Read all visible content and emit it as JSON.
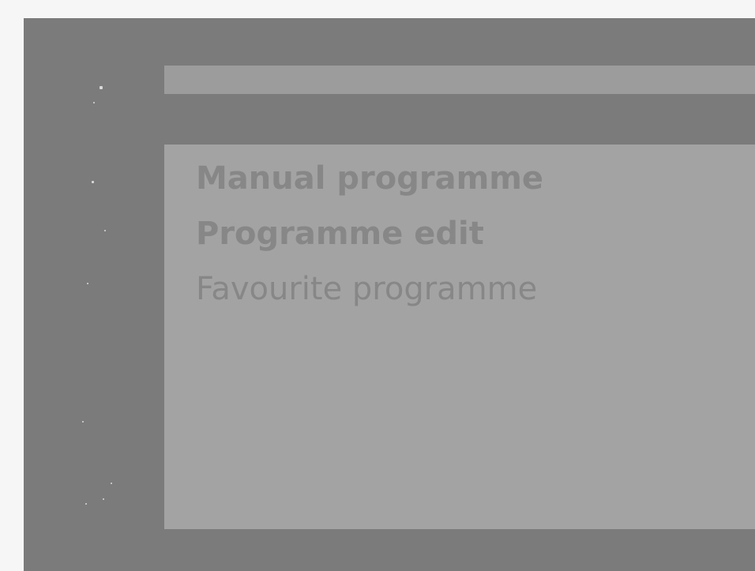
{
  "menu": {
    "items": [
      {
        "label": "Manual programme"
      },
      {
        "label": "Programme edit"
      },
      {
        "label": "Favourite programme"
      }
    ]
  },
  "colors": {
    "background": "#7b7b7b",
    "panel": "#a3a3a3",
    "title_bar": "#9c9c9c",
    "text": "#878787"
  }
}
